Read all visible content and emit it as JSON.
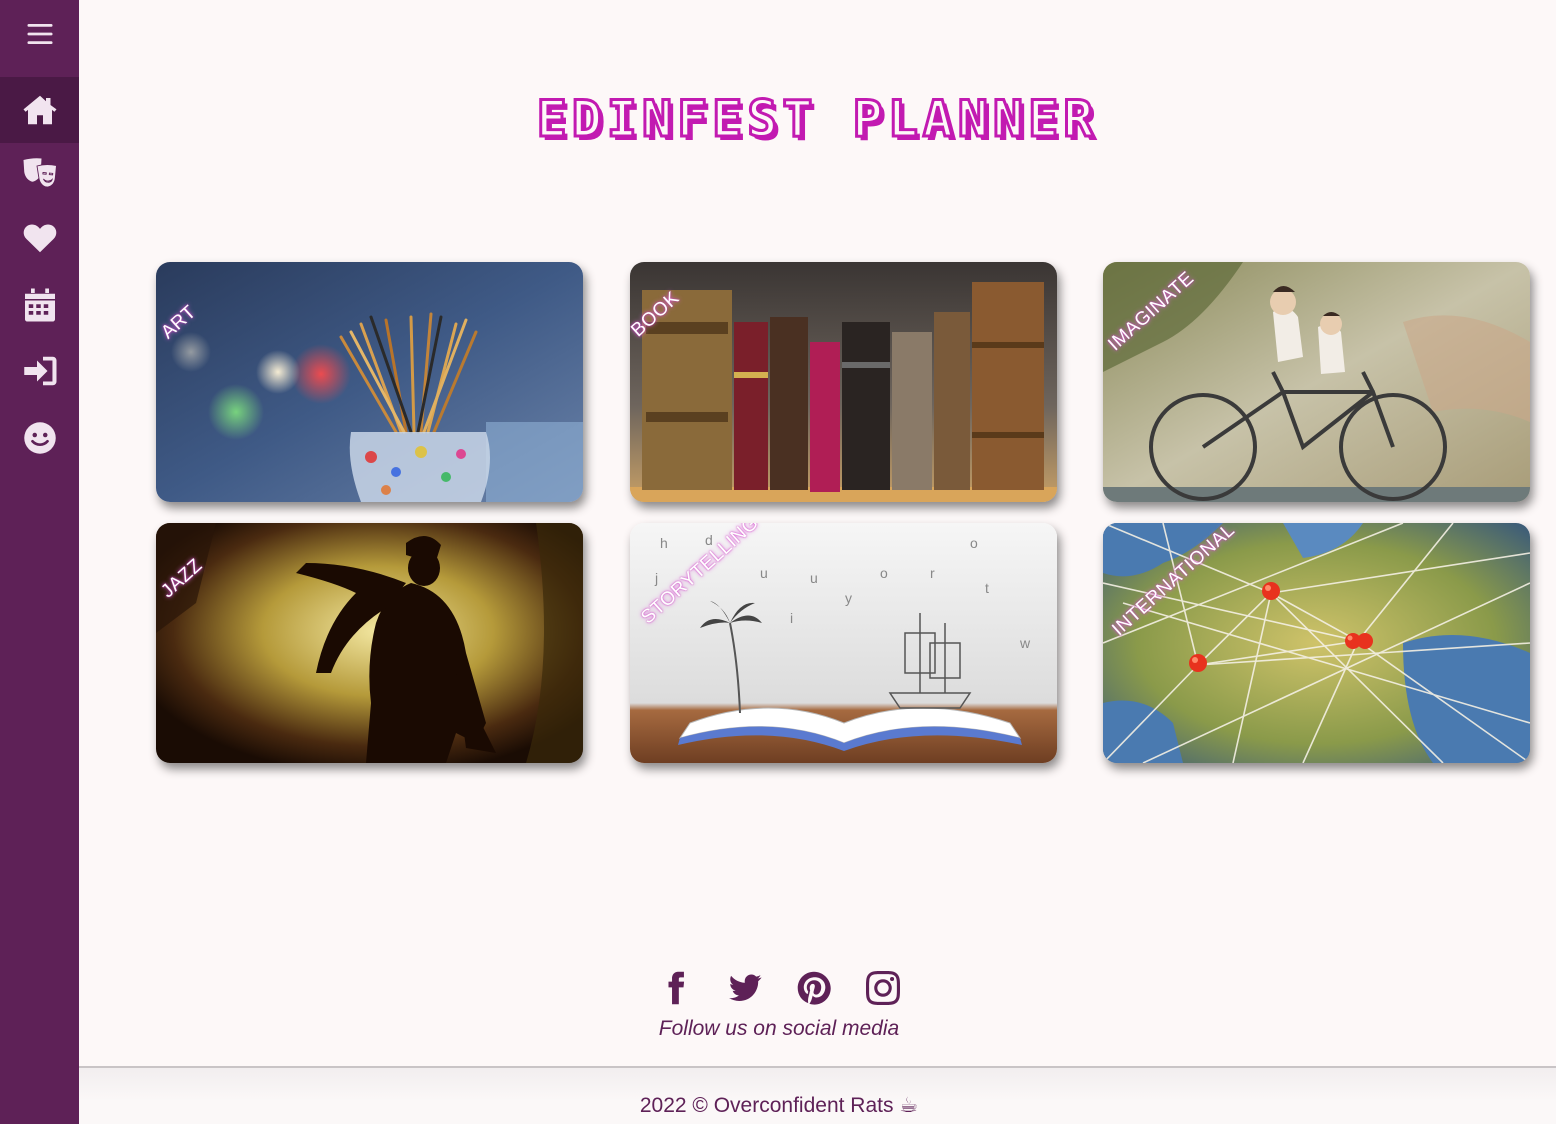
{
  "title": "EDINFEST PLANNER",
  "sidebar": {
    "items": [
      {
        "icon": "menu-icon"
      },
      {
        "icon": "home-icon",
        "active": true
      },
      {
        "icon": "theater-masks-icon"
      },
      {
        "icon": "heart-icon"
      },
      {
        "icon": "calendar-icon"
      },
      {
        "icon": "sign-in-icon"
      },
      {
        "icon": "smile-icon"
      }
    ]
  },
  "cards": [
    {
      "label": "ART",
      "image": "paint-brushes-in-jar"
    },
    {
      "label": "BOOK",
      "image": "old-books-on-shelf"
    },
    {
      "label": "IMAGINATE",
      "image": "children-on-bicycle-mural"
    },
    {
      "label": "JAZZ",
      "image": "saxophone-player-silhouette"
    },
    {
      "label": "STORYTELLING",
      "image": "open-book-with-ship-and-palm"
    },
    {
      "label": "INTERNATIONAL",
      "image": "world-map-with-pins"
    }
  ],
  "footer": {
    "social": [
      {
        "icon": "facebook-icon"
      },
      {
        "icon": "twitter-icon"
      },
      {
        "icon": "pinterest-icon"
      },
      {
        "icon": "instagram-icon"
      }
    ],
    "follow_text": "Follow us on social media",
    "copyright": "2022 © Overconfident Rats ☕"
  },
  "colors": {
    "sidebar": "#5e2157",
    "sidebar_active": "#4a1945",
    "title_stroke": "#c21ab1",
    "background": "#fdf8f8",
    "footer_text": "#5e2157"
  }
}
